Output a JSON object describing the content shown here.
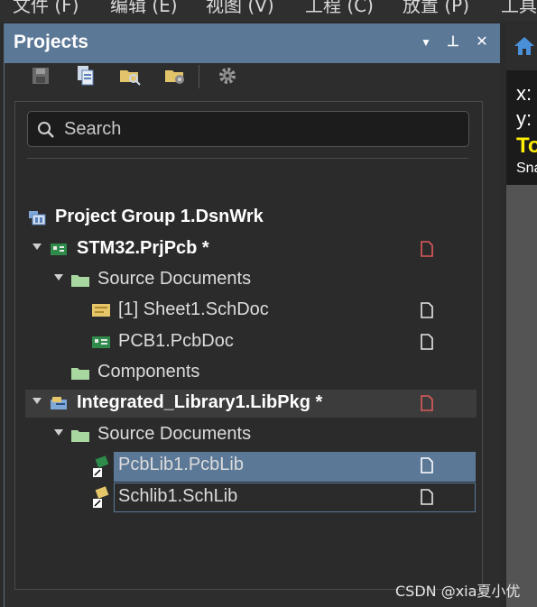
{
  "menubar": {
    "items": [
      {
        "label": "文件 (F)"
      },
      {
        "label": "编辑 (E)"
      },
      {
        "label": "视图 (V)"
      },
      {
        "label": "工程 (C)"
      },
      {
        "label": "放置 (P)"
      },
      {
        "label": "工具"
      }
    ]
  },
  "panel": {
    "title": "Projects",
    "header_icons": [
      "dropdown-arrow-icon",
      "pin-icon",
      "close-icon"
    ],
    "header_glyphs": {
      "menu": "▼",
      "pin": "⊥",
      "close": "✕"
    }
  },
  "toolbar": {
    "icons": [
      "save-icon",
      "save-all-icon",
      "open-project-icon",
      "project-options-icon",
      "settings-gear-icon"
    ]
  },
  "search": {
    "placeholder": "Search"
  },
  "tree": {
    "project_group": "Project Group 1.DsnWrk",
    "stm32": {
      "label": "STM32.PrjPcb *",
      "modified": true
    },
    "stm32_source_documents": "Source Documents",
    "sheet1": "[1] Sheet1.SchDoc",
    "pcb1": "PCB1.PcbDoc",
    "components": "Components",
    "integrated_library": {
      "label": "Integrated_Library1.LibPkg *",
      "modified": true
    },
    "lib_source_documents": "Source Documents",
    "pcblib": "PcbLib1.PcbLib",
    "schlib": "Schlib1.SchLib"
  },
  "right_pane": {
    "x_label": "x:",
    "y_label": "y:",
    "yellow_text": "To",
    "snap_text": "Sna",
    "home_icon": "home-icon"
  },
  "watermark": "CSDN @xia夏小优",
  "colors": {
    "panel_header": "#5b7897",
    "selected_row": "#5b7897",
    "modified_doc_icon": "#e05a5a",
    "folder": "#a8d8a0",
    "yellow_text": "#ffee00"
  }
}
